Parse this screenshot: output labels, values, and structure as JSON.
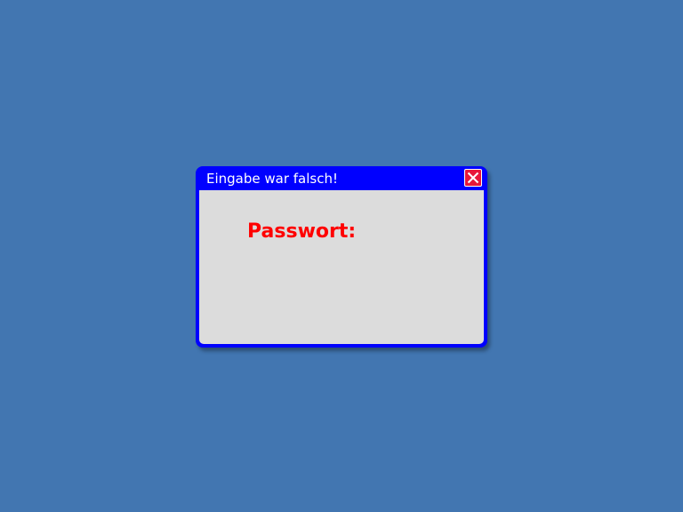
{
  "desktop": {
    "background_color": "#4276b1"
  },
  "dialog": {
    "title": "Eingabe war falsch!",
    "title_color": "#ffffff",
    "frame_color": "#0000ff",
    "body_color": "#dcdcdc",
    "close_button": {
      "icon": "close-icon",
      "color": "#e8183a"
    },
    "label": "Passwort:",
    "label_color": "#ff0000"
  }
}
